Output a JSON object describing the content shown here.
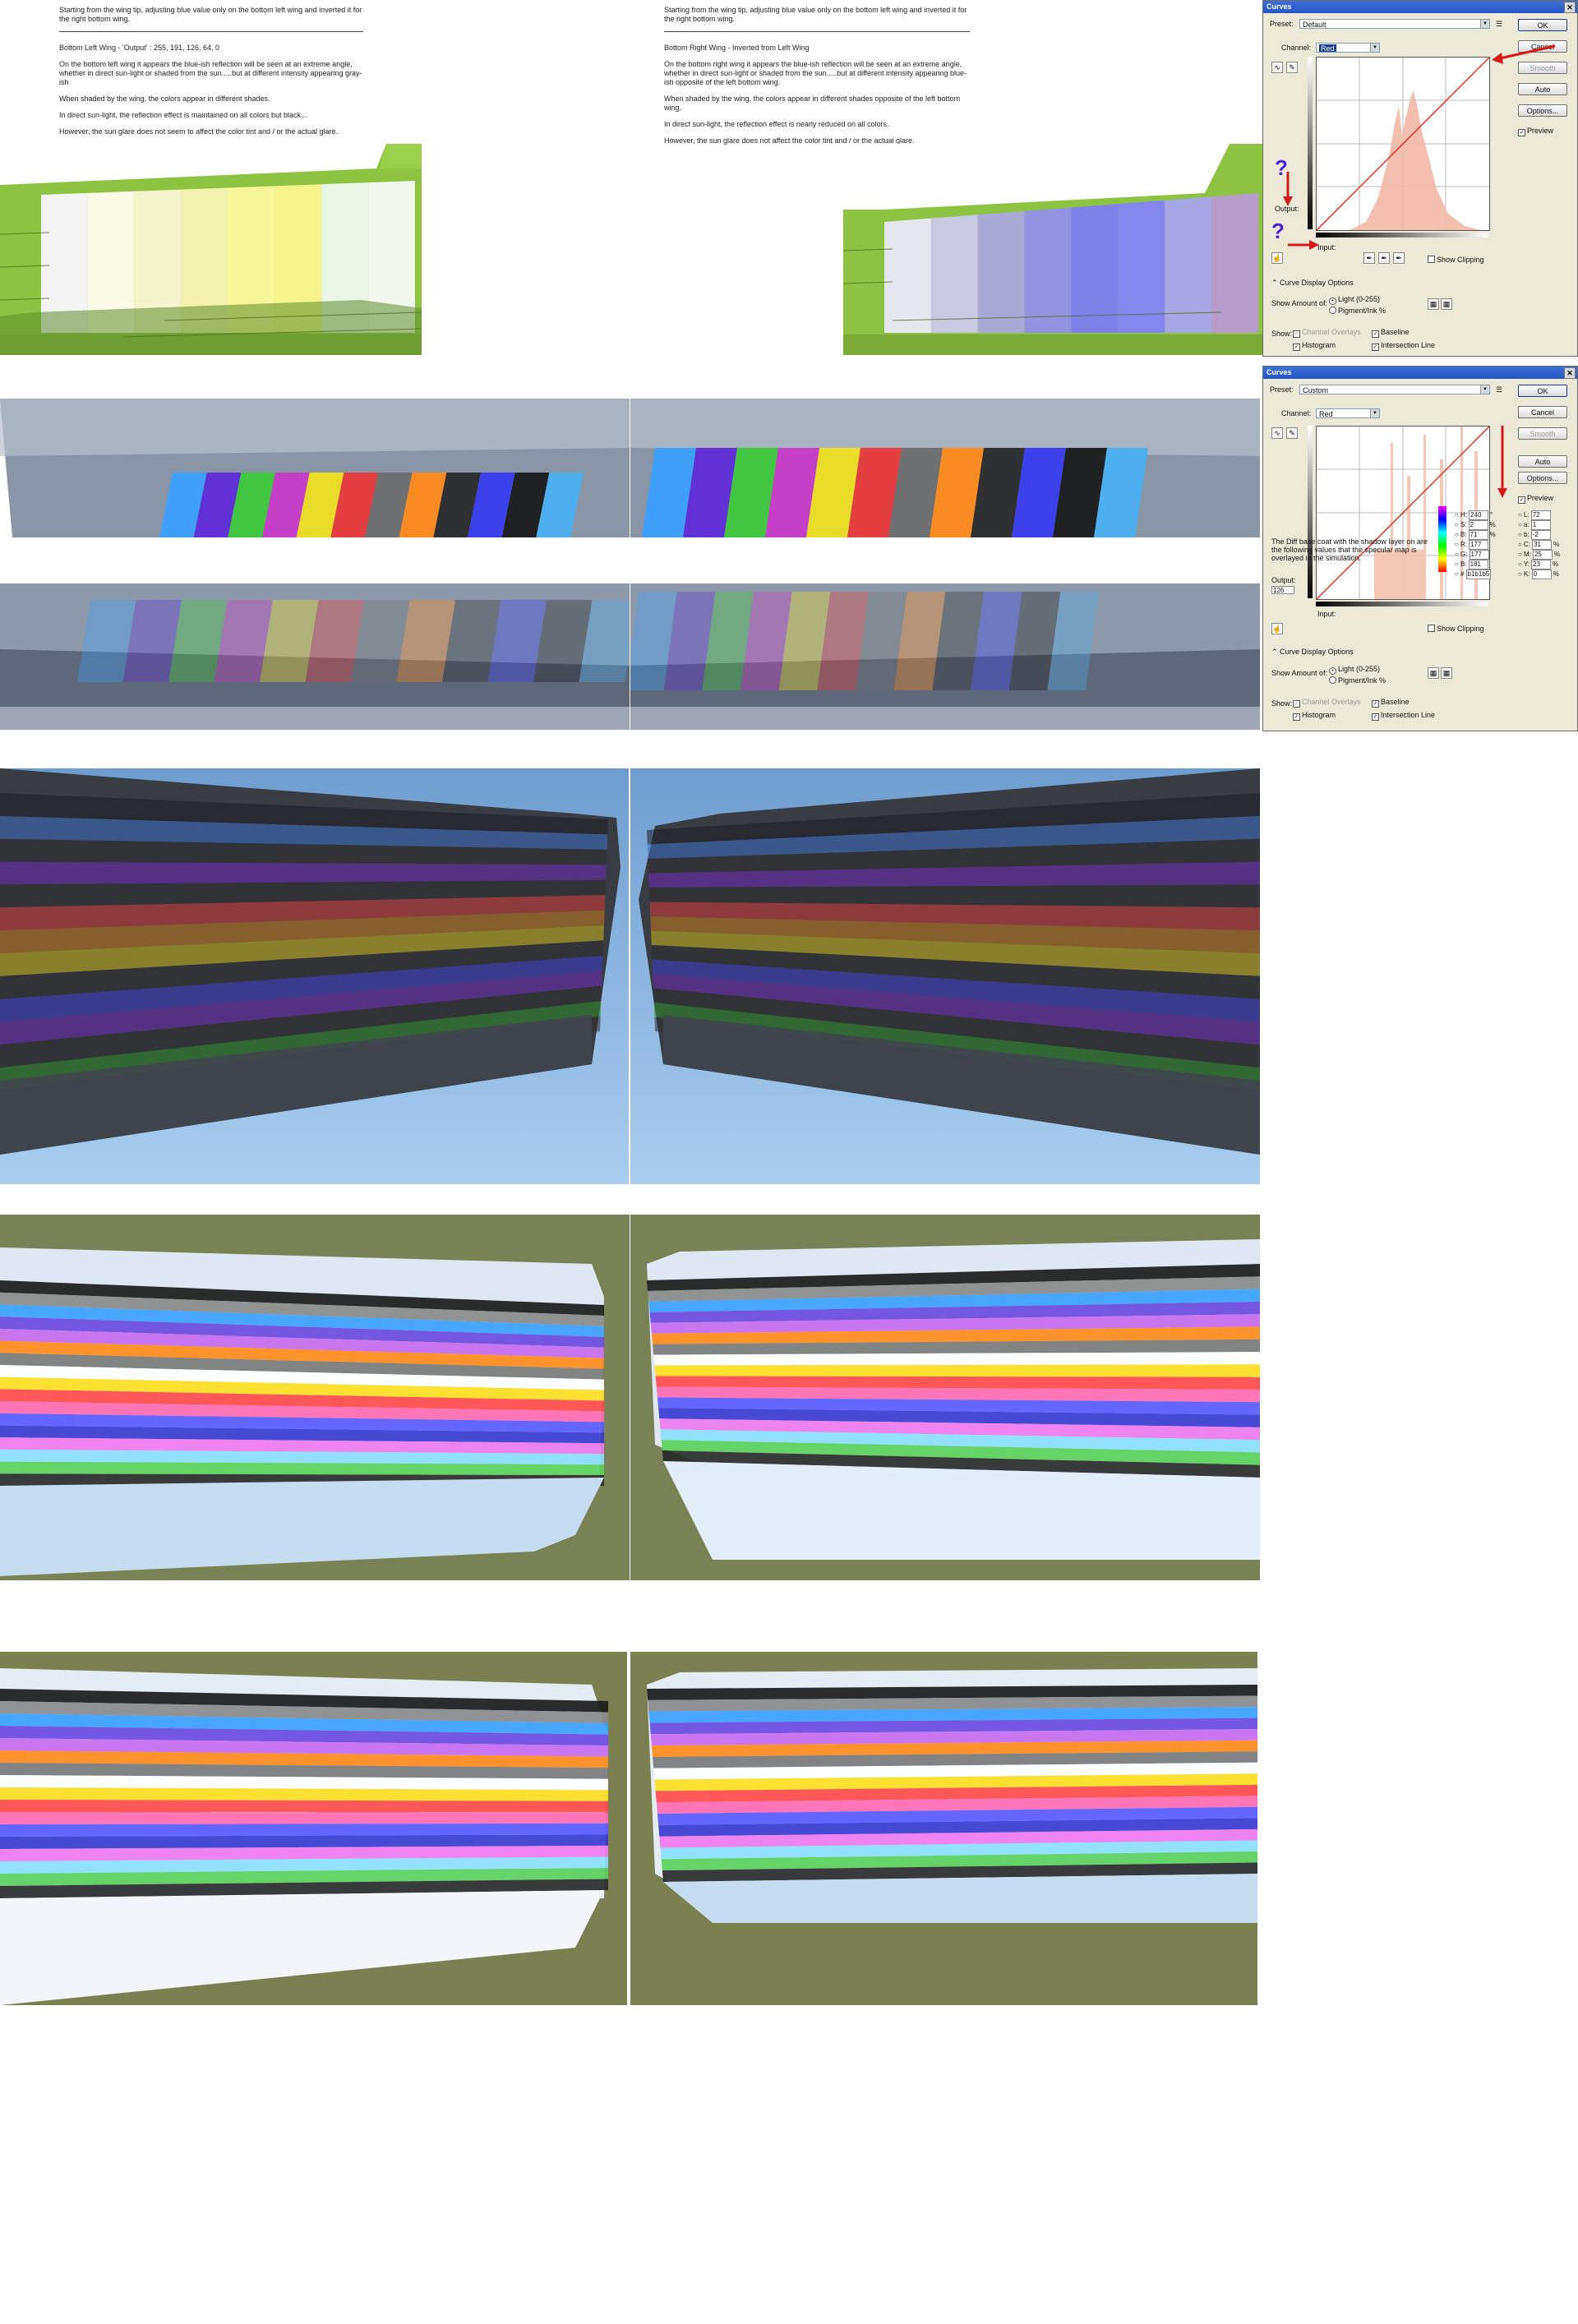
{
  "notes_left": {
    "intro": "Starting from the wing tip, adjusting blue value only on the bottom left wing and inverted it for the right bottom wing.",
    "heading": "Bottom Left Wing -   'Output' :  255, 191, 126, 64, 0",
    "p1": "On the bottom left wing it appears the blue-ish reflection will be seen at an extreme angle, whether in direct sun-light or shaded from the sun.....but at different intensity appearing gray-ish",
    "p2": "When shaded by the wing, the colors appear in different shades.",
    "p3": "In direct sun-light, the reflection effect is maintained on all colors but black...",
    "p4": "However, the sun glare does not seem to affect the color tint and / or the actual glare."
  },
  "notes_right": {
    "intro": "Starting from the wing tip, adjusting blue value only on the bottom left wing and inverted it for the right bottom wing.",
    "heading": "Bottom Right Wing -   Inverted from Left Wing",
    "p1": "On the bottom right wing it appears the blue-ish reflection will be seen at an extreme angle, whether in direct sun-light or shaded from the sun.....but at different intensity appearing blue-ish opposite of the left bottom wing.",
    "p2": "When shaded by the wing, the colors appear in different shades opposite of the left bottom wing.",
    "p3": "In direct sun-light, the reflection effect is nearly reduced on all colors.",
    "p4": "However, the sun glare does not affect the color tint and / or the actual glare."
  },
  "dialog1": {
    "title": "Curves",
    "preset_label": "Preset:",
    "preset_value": "Default",
    "channel_label": "Channel:",
    "channel_value": "Red",
    "ok": "OK",
    "cancel": "Cancel",
    "smooth": "Smooth",
    "auto": "Auto",
    "options": "Options...",
    "preview": "Preview",
    "output_label": "Output:",
    "input_label": "Input:",
    "show_clipping": "Show Clipping",
    "display_options": "Curve Display Options",
    "show_amount": "Show Amount of:",
    "light": "Light  (0-255)",
    "pigment": "Pigment/Ink %",
    "show_label": "Show:",
    "channel_overlays": "Channel Overlays",
    "baseline": "Baseline",
    "histogram": "Histogram",
    "intersection": "Intersection Line",
    "question": "?"
  },
  "dialog2": {
    "title": "Curves",
    "preset_label": "Preset:",
    "preset_value": "Custom",
    "channel_label": "Channel:",
    "channel_value": "Red",
    "ok": "OK",
    "cancel": "Cancel",
    "smooth": "Smooth",
    "auto": "Auto",
    "options": "Options...",
    "preview": "Preview",
    "output_label": "Output:",
    "output_value": "126",
    "input_label": "Input:",
    "show_clipping": "Show Clipping",
    "display_options": "Curve Display Options",
    "show_amount": "Show Amount of:",
    "light": "Light  (0-255)",
    "pigment": "Pigment/Ink %",
    "show_label": "Show:",
    "channel_overlays": "Channel Overlays",
    "baseline": "Baseline",
    "histogram": "Histogram",
    "intersection": "Intersection Line",
    "note": "The Diff base coat with the shadow layer on are the following values that the specular map is overlayed in the simulation.",
    "picker_left": [
      {
        "k": "H:",
        "v": "240",
        "u": "°"
      },
      {
        "k": "S:",
        "v": "2",
        "u": "%"
      },
      {
        "k": "B:",
        "v": "71",
        "u": "%"
      },
      {
        "k": "R:",
        "v": "177",
        "u": ""
      },
      {
        "k": "G:",
        "v": "177",
        "u": ""
      },
      {
        "k": "B:",
        "v": "181",
        "u": ""
      },
      {
        "k": "#",
        "v": "b1b1b5",
        "u": ""
      }
    ],
    "picker_right": [
      {
        "k": "L:",
        "v": "72",
        "u": ""
      },
      {
        "k": "a:",
        "v": "1",
        "u": ""
      },
      {
        "k": "b:",
        "v": "-2",
        "u": ""
      },
      {
        "k": "C:",
        "v": "31",
        "u": "%"
      },
      {
        "k": "M:",
        "v": "25",
        "u": "%"
      },
      {
        "k": "Y:",
        "v": "23",
        "u": "%"
      },
      {
        "k": "K:",
        "v": "0",
        "u": "%"
      }
    ]
  },
  "stripe_palette": {
    "pastel_test": [
      "#f3f3f3",
      "#fafae6",
      "#f5f5cc",
      "#f2f2ae",
      "#f7f79a",
      "#f5f58a",
      "#eaf6e6",
      "#f2f8ee"
    ],
    "blue_test": [
      "#e6e6ee",
      "#c8c8e0",
      "#a9a9d8",
      "#9393e2",
      "#8080ea",
      "#8686f0",
      "#a7a7e6",
      "#b69ccc"
    ],
    "ribbon": [
      "#3aa0ff",
      "#5e2bd6",
      "#3cc83a",
      "#c83ac8",
      "#f0e020",
      "#e83a3a",
      "#6e6e6e",
      "#ff8a1a",
      "#2a2a2a",
      "#3a3af0",
      "#1a1a1a",
      "#4ab0f0"
    ],
    "sky_bands": [
      "#1a1a22",
      "#3a6ec8",
      "#2c2c2c",
      "#6a2ab8",
      "#2c2c2c",
      "#d23a3a",
      "#c87a1a",
      "#c8b81a",
      "#2c2c2c",
      "#3a3ac8",
      "#6a2ab8",
      "#2c2c2c",
      "#2a8a2a",
      "#2c2c2c"
    ],
    "aerial_bands": [
      "#1a1a1a",
      "#8a8a8a",
      "#3aa0ff",
      "#6a4ae0",
      "#c86af0",
      "#ff8a1a",
      "#7a7a7a",
      "#ffffff",
      "#ffe020",
      "#ff4a4a",
      "#ff6ab0",
      "#5a5aff",
      "#3a3ad0",
      "#f07af0",
      "#8ae0ff",
      "#5ad05a",
      "#2a2a2a"
    ]
  }
}
